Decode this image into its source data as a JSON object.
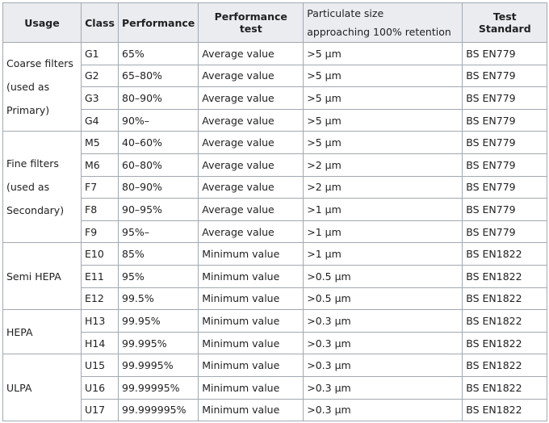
{
  "headers": {
    "usage": "Usage",
    "class": "Class",
    "performance": "Performance",
    "performance_test": "Performance test",
    "particulate_line1": "Particulate size",
    "particulate_line2": "approaching 100% retention",
    "test_standard": "Test Standard"
  },
  "groups": [
    {
      "usage_lines": [
        "Coarse filters",
        "(used as",
        "Primary)"
      ],
      "rows": [
        {
          "class": "G1",
          "performance": "65%",
          "test": "Average value",
          "size": ">5 μm",
          "standard": "BS EN779"
        },
        {
          "class": "G2",
          "performance": "65–80%",
          "test": "Average value",
          "size": ">5 μm",
          "standard": "BS EN779"
        },
        {
          "class": "G3",
          "performance": "80–90%",
          "test": "Average value",
          "size": ">5 μm",
          "standard": "BS EN779"
        },
        {
          "class": "G4",
          "performance": "90%–",
          "test": "Average value",
          "size": ">5 μm",
          "standard": "BS EN779"
        }
      ]
    },
    {
      "usage_lines": [
        "Fine filters",
        "(used as",
        "Secondary)"
      ],
      "rows": [
        {
          "class": "M5",
          "performance": "40–60%",
          "test": "Average value",
          "size": ">5 μm",
          "standard": "BS EN779"
        },
        {
          "class": "M6",
          "performance": "60–80%",
          "test": "Average value",
          "size": ">2 μm",
          "standard": "BS EN779"
        },
        {
          "class": "F7",
          "performance": "80–90%",
          "test": "Average value",
          "size": ">2 μm",
          "standard": "BS EN779"
        },
        {
          "class": "F8",
          "performance": "90–95%",
          "test": "Average value",
          "size": ">1 μm",
          "standard": "BS EN779"
        },
        {
          "class": "F9",
          "performance": "95%–",
          "test": "Average value",
          "size": ">1 μm",
          "standard": "BS EN779"
        }
      ]
    },
    {
      "usage_lines": [
        "Semi HEPA"
      ],
      "rows": [
        {
          "class": "E10",
          "performance": "85%",
          "test": "Minimum value",
          "size": ">1 μm",
          "standard": "BS EN1822"
        },
        {
          "class": "E11",
          "performance": "95%",
          "test": "Minimum value",
          "size": ">0.5 μm",
          "standard": "BS EN1822"
        },
        {
          "class": "E12",
          "performance": "99.5%",
          "test": "Minimum value",
          "size": ">0.5 μm",
          "standard": "BS EN1822"
        }
      ]
    },
    {
      "usage_lines": [
        "HEPA"
      ],
      "rows": [
        {
          "class": "H13",
          "performance": "99.95%",
          "test": "Minimum value",
          "size": ">0.3 μm",
          "standard": "BS EN1822"
        },
        {
          "class": "H14",
          "performance": "99.995%",
          "test": "Minimum value",
          "size": ">0.3 μm",
          "standard": "BS EN1822"
        }
      ]
    },
    {
      "usage_lines": [
        "ULPA"
      ],
      "rows": [
        {
          "class": "U15",
          "performance": "99.9995%",
          "test": "Minimum value",
          "size": ">0.3 μm",
          "standard": "BS EN1822"
        },
        {
          "class": "U16",
          "performance": "99.99995%",
          "test": "Minimum value",
          "size": ">0.3 μm",
          "standard": "BS EN1822"
        },
        {
          "class": "U17",
          "performance": "99.999995%",
          "test": "Minimum value",
          "size": ">0.3 μm",
          "standard": "BS EN1822"
        }
      ]
    }
  ]
}
